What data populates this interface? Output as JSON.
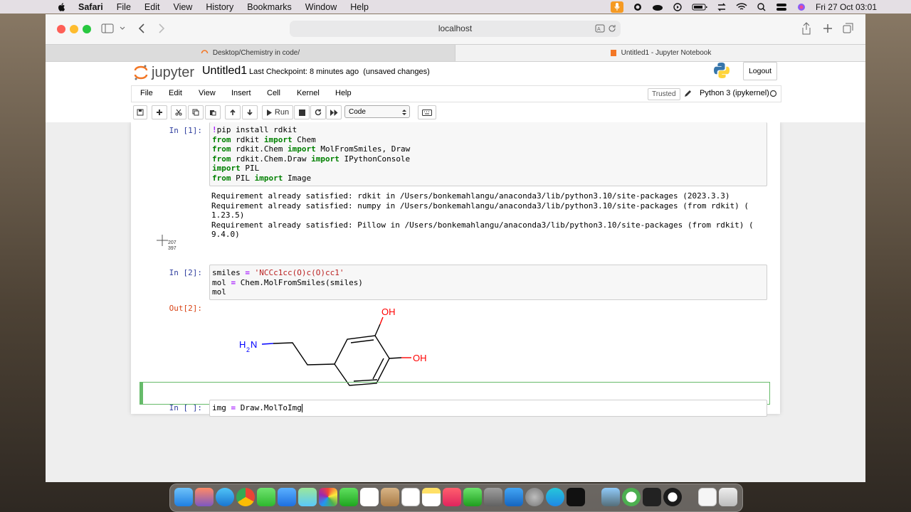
{
  "menubar": {
    "app": "Safari",
    "items": [
      "File",
      "Edit",
      "View",
      "History",
      "Bookmarks",
      "Window",
      "Help"
    ],
    "datetime": "Fri 27 Oct  03:01"
  },
  "browser": {
    "address": "localhost",
    "tabs": [
      {
        "label": "Desktop/Chemistry in code/"
      },
      {
        "label": "Untitled1 - Jupyter Notebook"
      }
    ]
  },
  "jupyter": {
    "logo_text": "jupyter",
    "notebook_title": "Untitled1",
    "checkpoint": "Last Checkpoint: 8 minutes ago",
    "unsaved": "(unsaved changes)",
    "logout_label": "Logout",
    "menu": [
      "File",
      "Edit",
      "View",
      "Insert",
      "Cell",
      "Kernel",
      "Help"
    ],
    "trusted": "Trusted",
    "kernel": "Python 3 (ipykernel)",
    "run_label": "Run",
    "cell_type": "Code"
  },
  "cells": {
    "c1": {
      "prompt": "In [1]:",
      "output": [
        "Requirement already satisfied: rdkit in /Users/bonkemahlangu/anaconda3/lib/python3.10/site-packages (2023.3.3)",
        "Requirement already satisfied: numpy in /Users/bonkemahlangu/anaconda3/lib/python3.10/site-packages (from rdkit) (",
        "1.23.5)",
        "Requirement already satisfied: Pillow in /Users/bonkemahlangu/anaconda3/lib/python3.10/site-packages (from rdkit) (",
        "9.4.0)"
      ]
    },
    "c2": {
      "prompt": "In [2]:",
      "out_prompt": "Out[2]:"
    },
    "c3": {
      "prompt": "In [ ]:"
    }
  },
  "molecule": {
    "atoms": {
      "oh_top": "OH",
      "oh_right": "OH",
      "amine_h": "H",
      "amine_sub": "2",
      "amine_n": "N"
    }
  },
  "cursor": {
    "x_readout": "207",
    "y_readout": "397"
  },
  "colors": {
    "in_prompt": "#303f9f",
    "out_prompt": "#d84315",
    "keyword": "#008000",
    "string": "#ba2121",
    "oxygen": "#ff0000",
    "nitrogen": "#0000ff",
    "selected_cell": "#66bb6a"
  }
}
